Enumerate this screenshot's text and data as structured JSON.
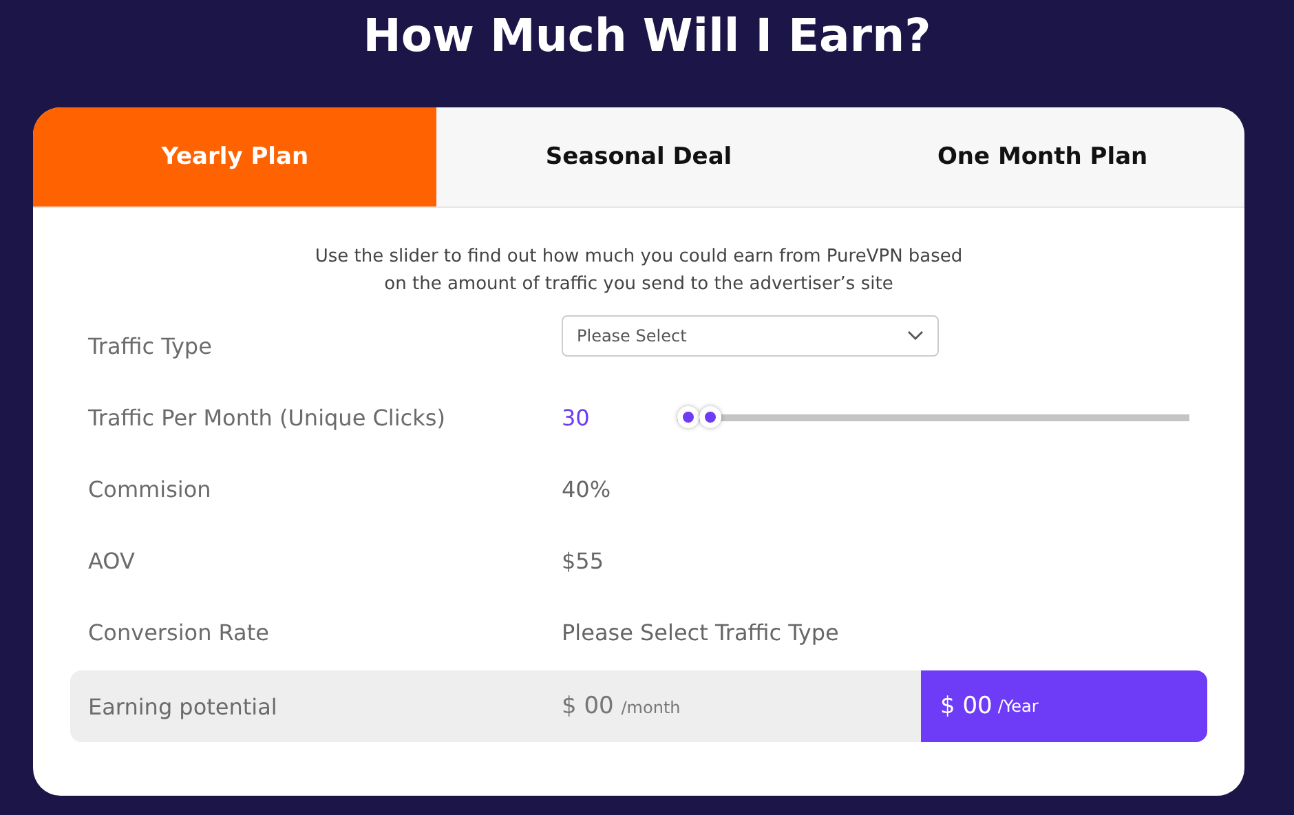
{
  "title": "How Much Will I Earn?",
  "tabs": [
    {
      "label": "Yearly Plan",
      "selected": true
    },
    {
      "label": "Seasonal Deal",
      "selected": false
    },
    {
      "label": "One Month Plan",
      "selected": false
    }
  ],
  "intro": "Use the slider to find out how much you could earn from PureVPN based on the amount of traffic you send to the advertiser’s site",
  "rows": [
    {
      "kind": "select",
      "label": "Traffic Type",
      "placeholder": "Please Select"
    },
    {
      "kind": "slider",
      "label": "Traffic Per Month (Unique Clicks)",
      "value": "30",
      "level": 0.065
    },
    {
      "kind": "text",
      "label": "Commision",
      "value": "40%"
    },
    {
      "kind": "text",
      "label": "AOV",
      "value": "$55"
    },
    {
      "kind": "text",
      "label": "Conversion Rate",
      "value": "Please Select Traffic Type"
    }
  ],
  "earning": {
    "label": "Earning potential",
    "monthly": {
      "amount": "$ 00",
      "unit": "/month"
    },
    "yearly": {
      "amount": "$ 00",
      "unit": "/Year"
    }
  }
}
